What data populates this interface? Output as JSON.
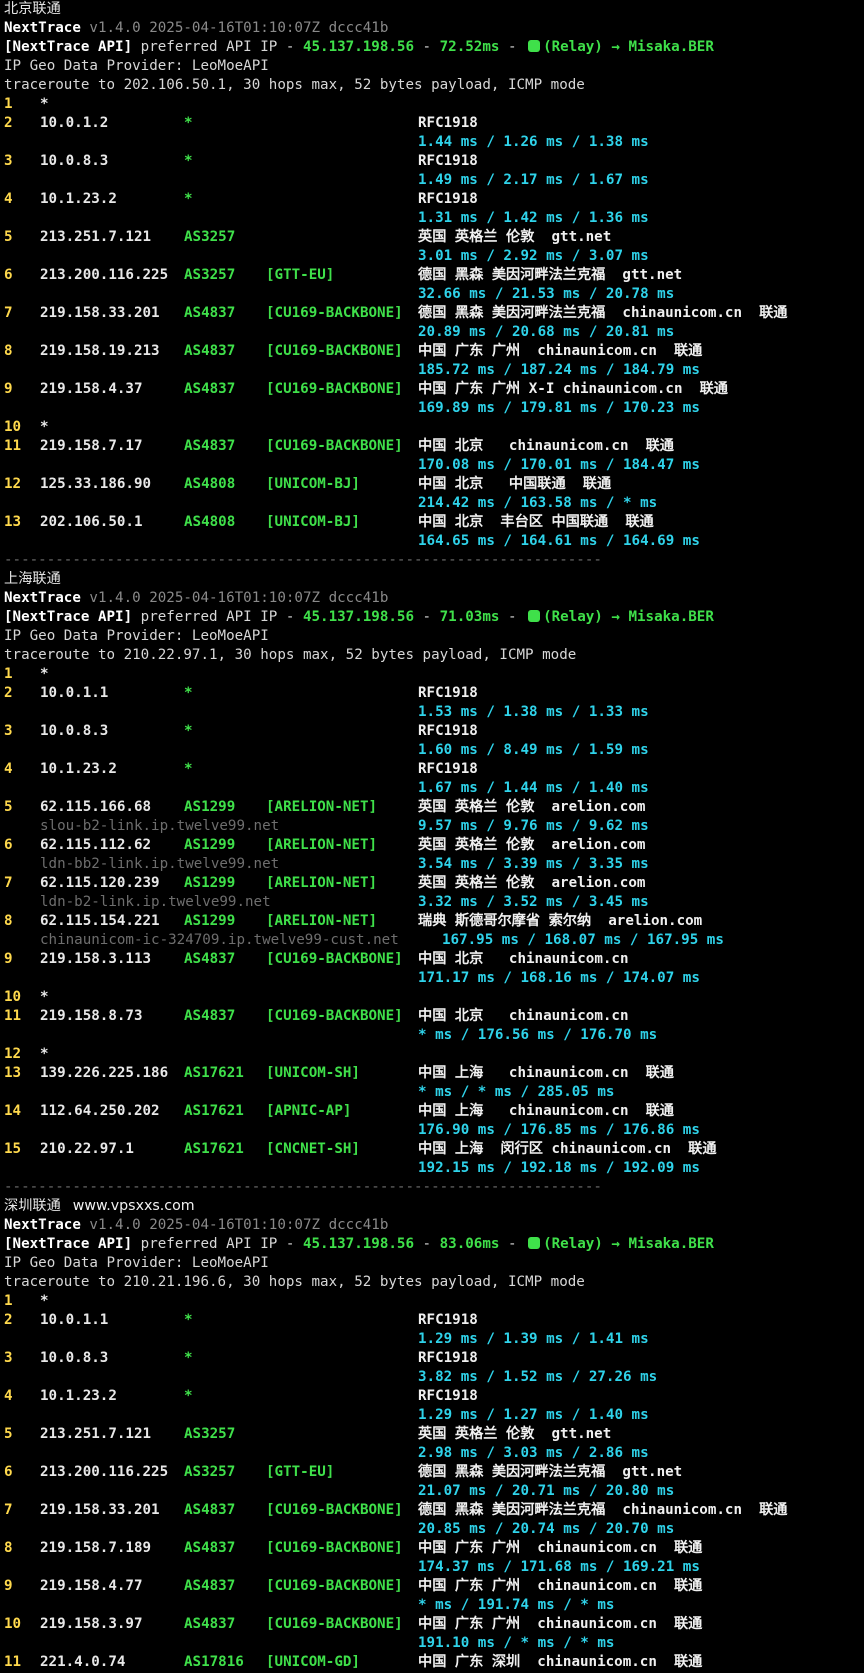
{
  "sections": [
    {
      "title": "北京联通",
      "site": "",
      "version_line": "NextTrace v1.4.0 2025-04-16T01:10:07Z dccc41b",
      "api_ip": "45.137.198.56",
      "api_ms": "72.52ms",
      "relay": "(Relay) → Misaka.BER",
      "provider": "IP Geo Data Provider: LeoMoeAPI",
      "traceroute": "traceroute to 202.106.50.1, 30 hops max, 52 bytes payload, ICMP mode",
      "hops": [
        {
          "n": "1",
          "ip": "*"
        },
        {
          "n": "2",
          "ip": "10.0.1.2",
          "asn": "*",
          "tag": "",
          "geo": "RFC1918",
          "rtt": "1.44 ms / 1.26 ms / 1.38 ms"
        },
        {
          "n": "3",
          "ip": "10.0.8.3",
          "asn": "*",
          "tag": "",
          "geo": "RFC1918",
          "rtt": "1.49 ms / 2.17 ms / 1.67 ms"
        },
        {
          "n": "4",
          "ip": "10.1.23.2",
          "asn": "*",
          "tag": "",
          "geo": "RFC1918",
          "rtt": "1.31 ms / 1.42 ms / 1.36 ms"
        },
        {
          "n": "5",
          "ip": "213.251.7.121",
          "asn": "AS3257",
          "tag": "",
          "geo": "英国 英格兰 伦敦  gtt.net",
          "rtt": "3.01 ms / 2.92 ms / 3.07 ms"
        },
        {
          "n": "6",
          "ip": "213.200.116.225",
          "asn": "AS3257",
          "tag": "[GTT-EU]",
          "geo": "德国 黑森 美因河畔法兰克福  gtt.net",
          "rtt": "32.66 ms / 21.53 ms / 20.78 ms"
        },
        {
          "n": "7",
          "ip": "219.158.33.201",
          "asn": "AS4837",
          "tag": "[CU169-BACKBONE]",
          "geo": "德国 黑森 美因河畔法兰克福  chinaunicom.cn  联通",
          "rtt": "20.89 ms / 20.68 ms / 20.81 ms"
        },
        {
          "n": "8",
          "ip": "219.158.19.213",
          "asn": "AS4837",
          "tag": "[CU169-BACKBONE]",
          "geo": "中国 广东 广州  chinaunicom.cn  联通",
          "rtt": "185.72 ms / 187.24 ms / 184.79 ms"
        },
        {
          "n": "9",
          "ip": "219.158.4.37",
          "asn": "AS4837",
          "tag": "[CU169-BACKBONE]",
          "geo": "中国 广东 广州 X-I chinaunicom.cn  联通",
          "rtt": "169.89 ms / 179.81 ms / 170.23 ms"
        },
        {
          "n": "10",
          "ip": "*"
        },
        {
          "n": "11",
          "ip": "219.158.7.17",
          "asn": "AS4837",
          "tag": "[CU169-BACKBONE]",
          "geo": "中国 北京   chinaunicom.cn  联通",
          "rtt": "170.08 ms / 170.01 ms / 184.47 ms"
        },
        {
          "n": "12",
          "ip": "125.33.186.90",
          "asn": "AS4808",
          "tag": "[UNICOM-BJ]",
          "geo": "中国 北京   中国联通  联通",
          "rtt": "214.42 ms / 163.58 ms / * ms"
        },
        {
          "n": "13",
          "ip": "202.106.50.1",
          "asn": "AS4808",
          "tag": "[UNICOM-BJ]",
          "geo": "中国 北京  丰台区 中国联通  联通",
          "rtt": "164.65 ms / 164.61 ms / 164.69 ms"
        }
      ]
    },
    {
      "title": "上海联通",
      "site": "",
      "version_line": "NextTrace v1.4.0 2025-04-16T01:10:07Z dccc41b",
      "api_ip": "45.137.198.56",
      "api_ms": "71.03ms",
      "relay": "(Relay) → Misaka.BER",
      "provider": "IP Geo Data Provider: LeoMoeAPI",
      "traceroute": "traceroute to 210.22.97.1, 30 hops max, 52 bytes payload, ICMP mode",
      "hops": [
        {
          "n": "1",
          "ip": "*"
        },
        {
          "n": "2",
          "ip": "10.0.1.1",
          "asn": "*",
          "tag": "",
          "geo": "RFC1918",
          "rtt": "1.53 ms / 1.38 ms / 1.33 ms"
        },
        {
          "n": "3",
          "ip": "10.0.8.3",
          "asn": "*",
          "tag": "",
          "geo": "RFC1918",
          "rtt": "1.60 ms / 8.49 ms / 1.59 ms"
        },
        {
          "n": "4",
          "ip": "10.1.23.2",
          "asn": "*",
          "tag": "",
          "geo": "RFC1918",
          "rtt": "1.67 ms / 1.44 ms / 1.40 ms"
        },
        {
          "n": "5",
          "ip": "62.115.166.68",
          "asn": "AS1299",
          "tag": "[ARELION-NET]",
          "geo": "英国 英格兰 伦敦  arelion.com",
          "host": "slou-b2-link.ip.twelve99.net",
          "rtt": "9.57 ms / 9.76 ms / 9.62 ms"
        },
        {
          "n": "6",
          "ip": "62.115.112.62",
          "asn": "AS1299",
          "tag": "[ARELION-NET]",
          "geo": "英国 英格兰 伦敦  arelion.com",
          "host": "ldn-bb2-link.ip.twelve99.net",
          "rtt": "3.54 ms / 3.39 ms / 3.35 ms"
        },
        {
          "n": "7",
          "ip": "62.115.120.239",
          "asn": "AS1299",
          "tag": "[ARELION-NET]",
          "geo": "英国 英格兰 伦敦  arelion.com",
          "host": "ldn-b2-link.ip.twelve99.net",
          "rtt": "3.32 ms / 3.52 ms / 3.45 ms"
        },
        {
          "n": "8",
          "ip": "62.115.154.221",
          "asn": "AS1299",
          "tag": "[ARELION-NET]",
          "geo": "瑞典 斯德哥尔摩省 索尔纳  arelion.com",
          "host": "chinaunicom-ic-324709.ip.twelve99-cust.net",
          "rtt": "167.95 ms / 168.07 ms / 167.95 ms"
        },
        {
          "n": "9",
          "ip": "219.158.3.113",
          "asn": "AS4837",
          "tag": "[CU169-BACKBONE]",
          "geo": "中国 北京   chinaunicom.cn",
          "rtt": "171.17 ms / 168.16 ms / 174.07 ms"
        },
        {
          "n": "10",
          "ip": "*"
        },
        {
          "n": "11",
          "ip": "219.158.8.73",
          "asn": "AS4837",
          "tag": "[CU169-BACKBONE]",
          "geo": "中国 北京   chinaunicom.cn",
          "rtt": "* ms / 176.56 ms / 176.70 ms"
        },
        {
          "n": "12",
          "ip": "*"
        },
        {
          "n": "13",
          "ip": "139.226.225.186",
          "asn": "AS17621",
          "tag": "[UNICOM-SH]",
          "geo": "中国 上海   chinaunicom.cn  联通",
          "rtt": "* ms / * ms / 285.05 ms"
        },
        {
          "n": "14",
          "ip": "112.64.250.202",
          "asn": "AS17621",
          "tag": "[APNIC-AP]",
          "geo": "中国 上海   chinaunicom.cn  联通",
          "rtt": "176.90 ms / 176.85 ms / 176.86 ms"
        },
        {
          "n": "15",
          "ip": "210.22.97.1",
          "asn": "AS17621",
          "tag": "[CNCNET-SH]",
          "geo": "中国 上海  闵行区 chinaunicom.cn  联通",
          "rtt": "192.15 ms / 192.18 ms / 192.09 ms"
        }
      ]
    },
    {
      "title": "深圳联通",
      "site": "www.vpsxxs.com",
      "version_line": "NextTrace v1.4.0 2025-04-16T01:10:07Z dccc41b",
      "api_ip": "45.137.198.56",
      "api_ms": "83.06ms",
      "relay": "(Relay) → Misaka.BER",
      "provider": "IP Geo Data Provider: LeoMoeAPI",
      "traceroute": "traceroute to 210.21.196.6, 30 hops max, 52 bytes payload, ICMP mode",
      "hops": [
        {
          "n": "1",
          "ip": "*"
        },
        {
          "n": "2",
          "ip": "10.0.1.1",
          "asn": "*",
          "tag": "",
          "geo": "RFC1918",
          "rtt": "1.29 ms / 1.39 ms / 1.41 ms"
        },
        {
          "n": "3",
          "ip": "10.0.8.3",
          "asn": "*",
          "tag": "",
          "geo": "RFC1918",
          "rtt": "3.82 ms / 1.52 ms / 27.26 ms"
        },
        {
          "n": "4",
          "ip": "10.1.23.2",
          "asn": "*",
          "tag": "",
          "geo": "RFC1918",
          "rtt": "1.29 ms / 1.27 ms / 1.40 ms"
        },
        {
          "n": "5",
          "ip": "213.251.7.121",
          "asn": "AS3257",
          "tag": "",
          "geo": "英国 英格兰 伦敦  gtt.net",
          "rtt": "2.98 ms / 3.03 ms / 2.86 ms"
        },
        {
          "n": "6",
          "ip": "213.200.116.225",
          "asn": "AS3257",
          "tag": "[GTT-EU]",
          "geo": "德国 黑森 美因河畔法兰克福  gtt.net",
          "rtt": "21.07 ms / 20.71 ms / 20.80 ms"
        },
        {
          "n": "7",
          "ip": "219.158.33.201",
          "asn": "AS4837",
          "tag": "[CU169-BACKBONE]",
          "geo": "德国 黑森 美因河畔法兰克福  chinaunicom.cn  联通",
          "rtt": "20.85 ms / 20.74 ms / 20.70 ms"
        },
        {
          "n": "8",
          "ip": "219.158.7.189",
          "asn": "AS4837",
          "tag": "[CU169-BACKBONE]",
          "geo": "中国 广东 广州  chinaunicom.cn  联通",
          "rtt": "174.37 ms / 171.68 ms / 169.21 ms"
        },
        {
          "n": "9",
          "ip": "219.158.4.77",
          "asn": "AS4837",
          "tag": "[CU169-BACKBONE]",
          "geo": "中国 广东 广州  chinaunicom.cn  联通",
          "rtt": "* ms / 191.74 ms / * ms"
        },
        {
          "n": "10",
          "ip": "219.158.3.97",
          "asn": "AS4837",
          "tag": "[CU169-BACKBONE]",
          "geo": "中国 广东 广州  chinaunicom.cn  联通",
          "rtt": "191.10 ms / * ms / * ms"
        },
        {
          "n": "11",
          "ip": "221.4.0.74",
          "asn": "AS17816",
          "tag": "[UNICOM-GD]",
          "geo": "中国 广东 深圳  chinaunicom.cn  联通"
        }
      ]
    }
  ],
  "separator": "------------------------------------------------------------------------",
  "labels": {
    "app": "NextTrace",
    "api_prefix": "[NextTrace API]",
    "api_mid": " preferred API IP - ",
    "dash": " - "
  },
  "colors": {
    "background": "#000000",
    "hop_number": "#ffd94d",
    "asn": "#3fe04a",
    "rtt": "#2fd3ea",
    "hostname": "#6e6e6e"
  }
}
